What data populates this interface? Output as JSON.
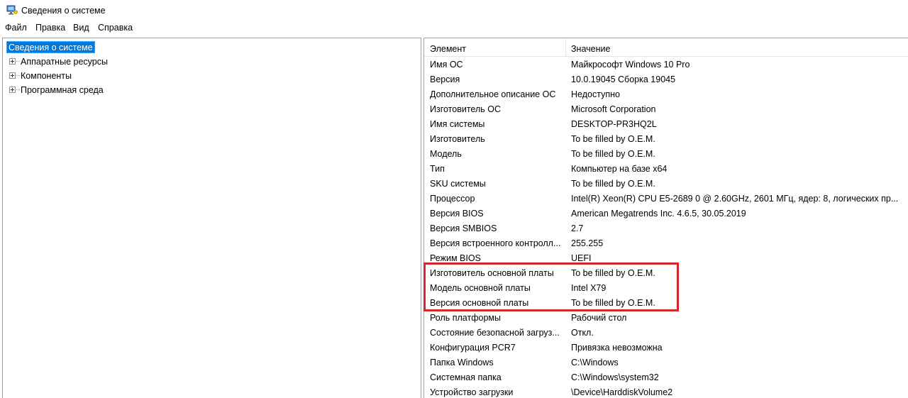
{
  "window": {
    "title": "Сведения о системе",
    "icon": "system-info-icon"
  },
  "menu": [
    "Файл",
    "Правка",
    "Вид",
    "Справка"
  ],
  "tree": {
    "root": "Сведения о системе",
    "children": [
      "Аппаратные ресурсы",
      "Компоненты",
      "Программная среда"
    ]
  },
  "list": {
    "columns": [
      "Элемент",
      "Значение"
    ],
    "rows": [
      [
        "Имя ОС",
        "Майкрософт Windows 10 Pro"
      ],
      [
        "Версия",
        "10.0.19045 Сборка 19045"
      ],
      [
        "Дополнительное описание ОС",
        "Недоступно"
      ],
      [
        "Изготовитель ОС",
        "Microsoft Corporation"
      ],
      [
        "Имя системы",
        "DESKTOP-PR3HQ2L"
      ],
      [
        "Изготовитель",
        "To be filled by O.E.M."
      ],
      [
        "Модель",
        "To be filled by O.E.M."
      ],
      [
        "Тип",
        "Компьютер на базе x64"
      ],
      [
        "SKU системы",
        "To be filled by O.E.M."
      ],
      [
        "Процессор",
        "Intel(R) Xeon(R) CPU E5-2689 0 @ 2.60GHz, 2601 МГц, ядер: 8, логических пр..."
      ],
      [
        "Версия BIOS",
        "American Megatrends Inc. 4.6.5, 30.05.2019"
      ],
      [
        "Версия SMBIOS",
        "2.7"
      ],
      [
        "Версия встроенного контролл...",
        "255.255"
      ],
      [
        "Режим BIOS",
        "UEFI"
      ],
      [
        "Изготовитель основной платы",
        "To be filled by O.E.M."
      ],
      [
        "Модель основной платы",
        "Intel X79"
      ],
      [
        "Версия основной платы",
        "To be filled by O.E.M."
      ],
      [
        "Роль платформы",
        "Рабочий стол"
      ],
      [
        "Состояние безопасной загруз...",
        "Откл."
      ],
      [
        "Конфигурация PCR7",
        "Привязка невозможна"
      ],
      [
        "Папка Windows",
        "C:\\Windows"
      ],
      [
        "Системная папка",
        "C:\\Windows\\system32"
      ],
      [
        "Устройство загрузки",
        "\\Device\\HarddiskVolume2"
      ]
    ]
  },
  "colors": {
    "selection": "#0078d7",
    "highlight_box": "#d7262c"
  }
}
